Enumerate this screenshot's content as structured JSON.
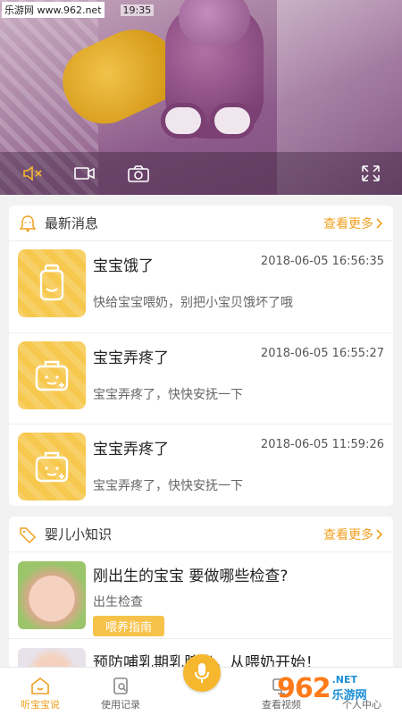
{
  "status": {
    "watermark": "乐游网 www.962.net",
    "time": "19:35"
  },
  "video": {
    "icons": [
      "mute-icon",
      "video-record-icon",
      "camera-icon",
      "fullscreen-icon"
    ]
  },
  "news": {
    "title": "最新消息",
    "more": "查看更多",
    "items": [
      {
        "title": "宝宝饿了",
        "date": "2018-06-05 16:56:35",
        "desc": "快给宝宝喂奶，别把小宝贝饿坏了哦"
      },
      {
        "title": "宝宝弄疼了",
        "date": "2018-06-05 16:55:27",
        "desc": "宝宝弄疼了，快快安抚一下"
      },
      {
        "title": "宝宝弄疼了",
        "date": "2018-06-05 11:59:26",
        "desc": "宝宝弄疼了，快快安抚一下"
      }
    ]
  },
  "knowledge": {
    "title": "婴儿小知识",
    "more": "查看更多",
    "items": [
      {
        "title": "刚出生的宝宝 要做哪些检查?",
        "sub": "出生检查",
        "tag": "喂养指南"
      },
      {
        "title": "预防哺乳期乳腺炎，从喂奶开始！"
      }
    ]
  },
  "nav": [
    {
      "label": "听宝宝说",
      "active": true
    },
    {
      "label": "使用记录"
    },
    {
      "label": ""
    },
    {
      "label": "查看视频"
    },
    {
      "label": "个人中心"
    }
  ],
  "brand": {
    "num": "962",
    "net": ".NET",
    "cn": "乐游网"
  },
  "colors": {
    "accent": "#f6b72f",
    "more": "#f0a020",
    "thumb": "#f7c84e"
  }
}
